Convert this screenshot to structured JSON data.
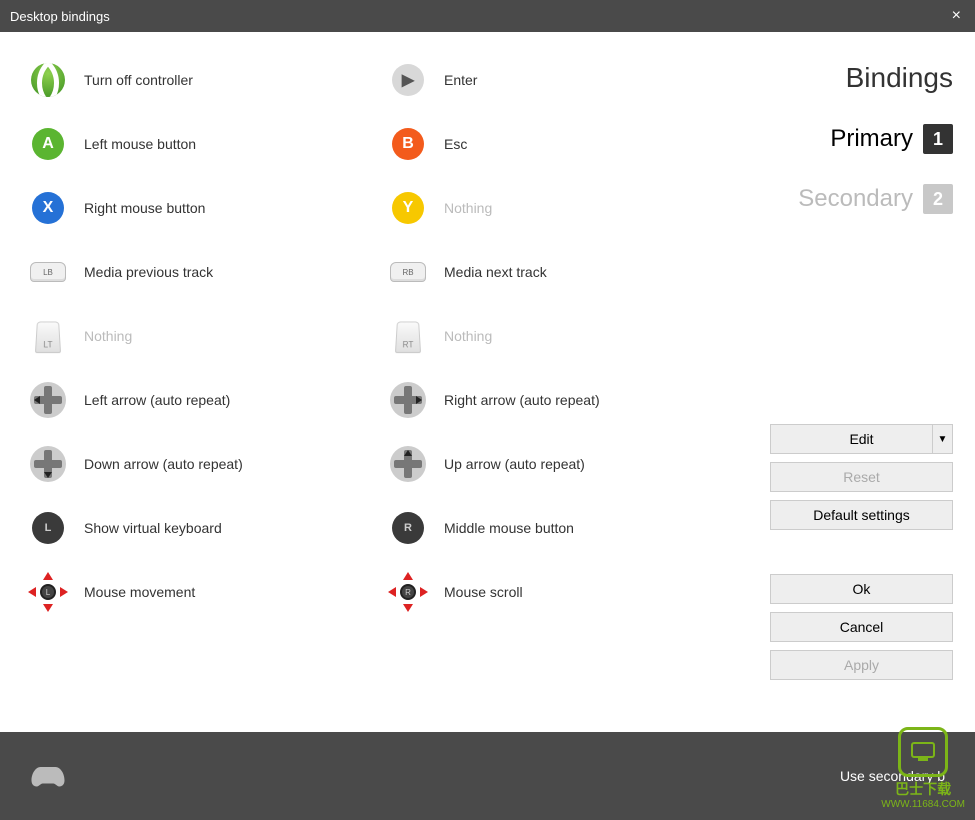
{
  "titlebar": {
    "title": "Desktop bindings",
    "close": "×"
  },
  "bindings": {
    "col1": [
      {
        "icon": "xbox",
        "label": "Turn off controller",
        "dim": false
      },
      {
        "icon": "a",
        "label": "Left mouse button",
        "dim": false
      },
      {
        "icon": "x",
        "label": "Right mouse button",
        "dim": false
      },
      {
        "icon": "lb",
        "label": "Media previous track",
        "dim": false
      },
      {
        "icon": "lt",
        "label": "Nothing",
        "dim": true
      },
      {
        "icon": "dpad-left",
        "label": "Left arrow (auto repeat)",
        "dim": false
      },
      {
        "icon": "dpad-down",
        "label": "Down arrow (auto repeat)",
        "dim": false
      },
      {
        "icon": "ls",
        "label": "Show virtual keyboard",
        "dim": false
      },
      {
        "icon": "ls-move",
        "label": "Mouse movement",
        "dim": false
      }
    ],
    "col2": [
      {
        "icon": "start",
        "label": "Enter",
        "dim": false
      },
      {
        "icon": "b",
        "label": "Esc",
        "dim": false
      },
      {
        "icon": "y",
        "label": "Nothing",
        "dim": true
      },
      {
        "icon": "rb",
        "label": "Media next track",
        "dim": false
      },
      {
        "icon": "rt",
        "label": "Nothing",
        "dim": true
      },
      {
        "icon": "dpad-right",
        "label": "Right arrow (auto repeat)",
        "dim": false
      },
      {
        "icon": "dpad-up",
        "label": "Up arrow (auto repeat)",
        "dim": false
      },
      {
        "icon": "rs",
        "label": "Middle mouse button",
        "dim": false
      },
      {
        "icon": "rs-move",
        "label": "Mouse scroll",
        "dim": false
      }
    ]
  },
  "sidebar": {
    "heading": "Bindings",
    "tabs": [
      {
        "label": "Primary",
        "num": "1",
        "active": true
      },
      {
        "label": "Secondary",
        "num": "2",
        "active": false
      }
    ],
    "buttons": {
      "edit": "Edit",
      "reset": "Reset",
      "defaults": "Default settings",
      "ok": "Ok",
      "cancel": "Cancel",
      "apply": "Apply"
    }
  },
  "footer": {
    "text": "Use secondary b"
  },
  "watermark": {
    "line1": "巴士下载",
    "line2": "WWW.11684.COM"
  }
}
